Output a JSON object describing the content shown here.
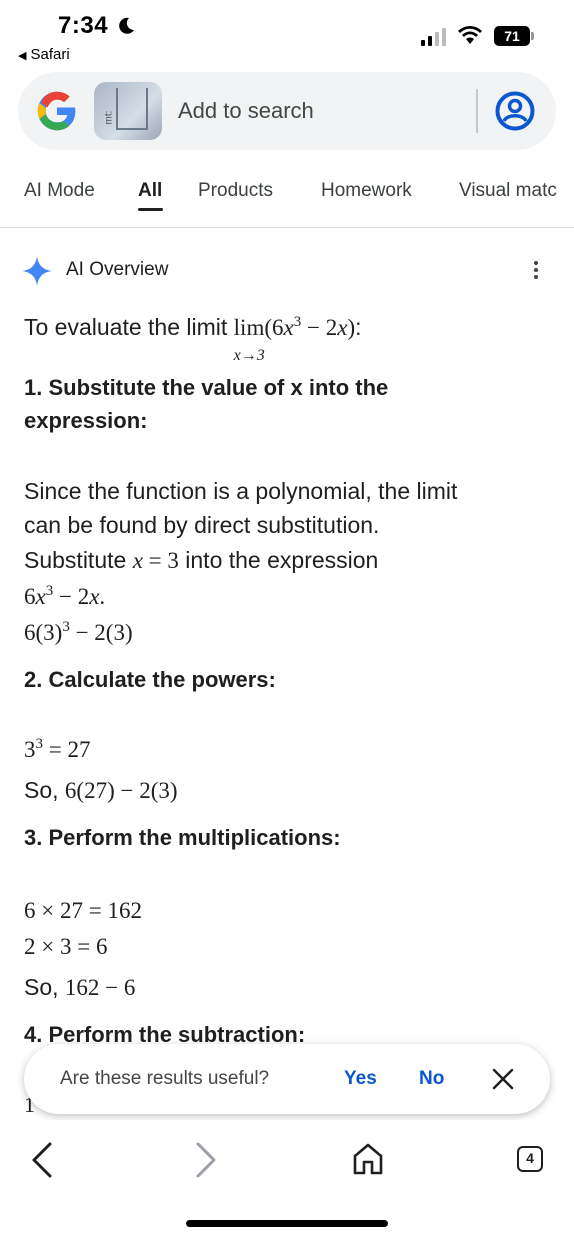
{
  "status": {
    "time": "7:34",
    "back_app": "Safari",
    "battery": "71"
  },
  "search": {
    "placeholder": "Add to search",
    "thumb_text": "mt:"
  },
  "tabs": [
    {
      "label": "AI Mode"
    },
    {
      "label": "All"
    },
    {
      "label": "Products"
    },
    {
      "label": "Homework"
    },
    {
      "label": "Visual matc"
    }
  ],
  "overview": {
    "title": "AI Overview",
    "intro": "To evaluate the limit ",
    "intro_end": ":",
    "step1_heading_a": "1. Substitute the value of x into the",
    "step1_heading_b": "expression:",
    "step1_text_a": "Since the function is a polynomial, the limit",
    "step1_text_b": "can be found by direct substitution.",
    "step1_text_c": "Substitute ",
    "step1_text_d": " into the expression",
    "step2_heading": "2. Calculate the powers:",
    "so": "So, ",
    "step3_heading": "3. Perform the multiplications:",
    "step4_heading": "4. Perform the subtraction:"
  },
  "feedback": {
    "question": "Are these results useful?",
    "yes": "Yes",
    "no": "No"
  },
  "toolbar": {
    "tab_count": "4"
  },
  "colors": {
    "link_blue": "#0b57d0",
    "search_bg": "#f1f3f4",
    "sparkle_blue": "#4285f4"
  }
}
